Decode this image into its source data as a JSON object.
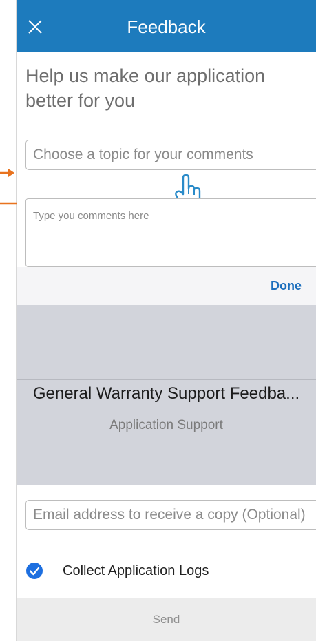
{
  "header": {
    "title": "Feedback"
  },
  "intro": {
    "text": "Help us make our application better for you"
  },
  "topic": {
    "placeholder": "Choose a topic for your comments"
  },
  "comments": {
    "placeholder": "Type you comments here"
  },
  "picker": {
    "done_label": "Done",
    "options": [
      "General Warranty Support Feedba...",
      "Application Support"
    ]
  },
  "email": {
    "placeholder": "Email address to receive a copy (Optional)"
  },
  "logs": {
    "label": "Collect Application Logs",
    "checked": true
  },
  "send": {
    "label": "Send"
  },
  "colors": {
    "header": "#1d7bbd",
    "accent": "#1d6fbd",
    "annotation": "#e8731f"
  },
  "icons": [
    "close-icon",
    "checkmark-circle-icon",
    "hand-pointer-icon",
    "arrow-icon"
  ]
}
